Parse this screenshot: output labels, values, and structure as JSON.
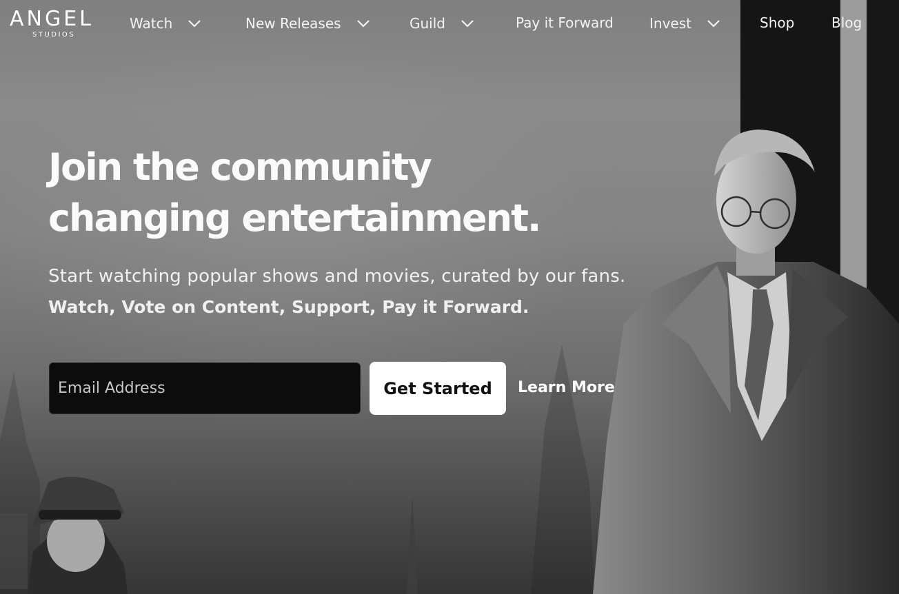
{
  "brand": {
    "name": "ANGEL",
    "subtitle": "STUDIOS"
  },
  "nav": {
    "items": [
      {
        "label": "Watch",
        "has_dropdown": true
      },
      {
        "label": "New Releases",
        "has_dropdown": true
      },
      {
        "label": "Guild",
        "has_dropdown": true
      },
      {
        "label": "Pay it Forward",
        "has_dropdown": false
      },
      {
        "label": "Invest",
        "has_dropdown": true
      },
      {
        "label": "Shop",
        "has_dropdown": false
      },
      {
        "label": "Blog",
        "has_dropdown": false
      }
    ]
  },
  "hero": {
    "headline_line1": "Join the community",
    "headline_line2": "changing entertainment.",
    "subtitle": "Start watching popular shows and movies, curated by our fans.",
    "tagline": "Watch, Vote on Content, Support, Pay it Forward.",
    "email_placeholder": "Email Address",
    "cta_label": "Get Started",
    "learn_more_label": "Learn More"
  },
  "colors": {
    "text": "#ffffff",
    "input_bg": "#0c0c0c",
    "cta_bg": "#ffffff",
    "cta_text": "#111111"
  },
  "icons": {
    "dropdown": "chevron-down-icon"
  }
}
